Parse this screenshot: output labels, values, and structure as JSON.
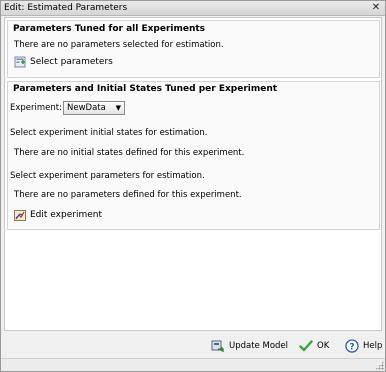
{
  "window": {
    "title": "Edit: Estimated Parameters",
    "close_glyph": "✕"
  },
  "panel_all": {
    "heading": "Parameters Tuned for all Experiments",
    "message": "There are no parameters selected for estimation.",
    "select_label": "Select parameters",
    "select_icon": "select-parameters-icon"
  },
  "panel_per": {
    "heading": "Parameters and Initial States Tuned per Experiment",
    "experiment_label": "Experiment:",
    "experiment_value": "NewData",
    "states_prompt": "Select experiment initial states for estimation.",
    "states_message": "There are no initial states defined for this experiment.",
    "params_prompt": "Select experiment parameters for estimation.",
    "params_message": "There are no parameters defined for this experiment.",
    "edit_label": "Edit experiment",
    "edit_icon": "edit-experiment-icon"
  },
  "footer": {
    "update_label": "Update Model",
    "ok_label": "OK",
    "help_label": "Help",
    "ok_color": "#3aa53a",
    "help_color": "#2a5fa8"
  }
}
